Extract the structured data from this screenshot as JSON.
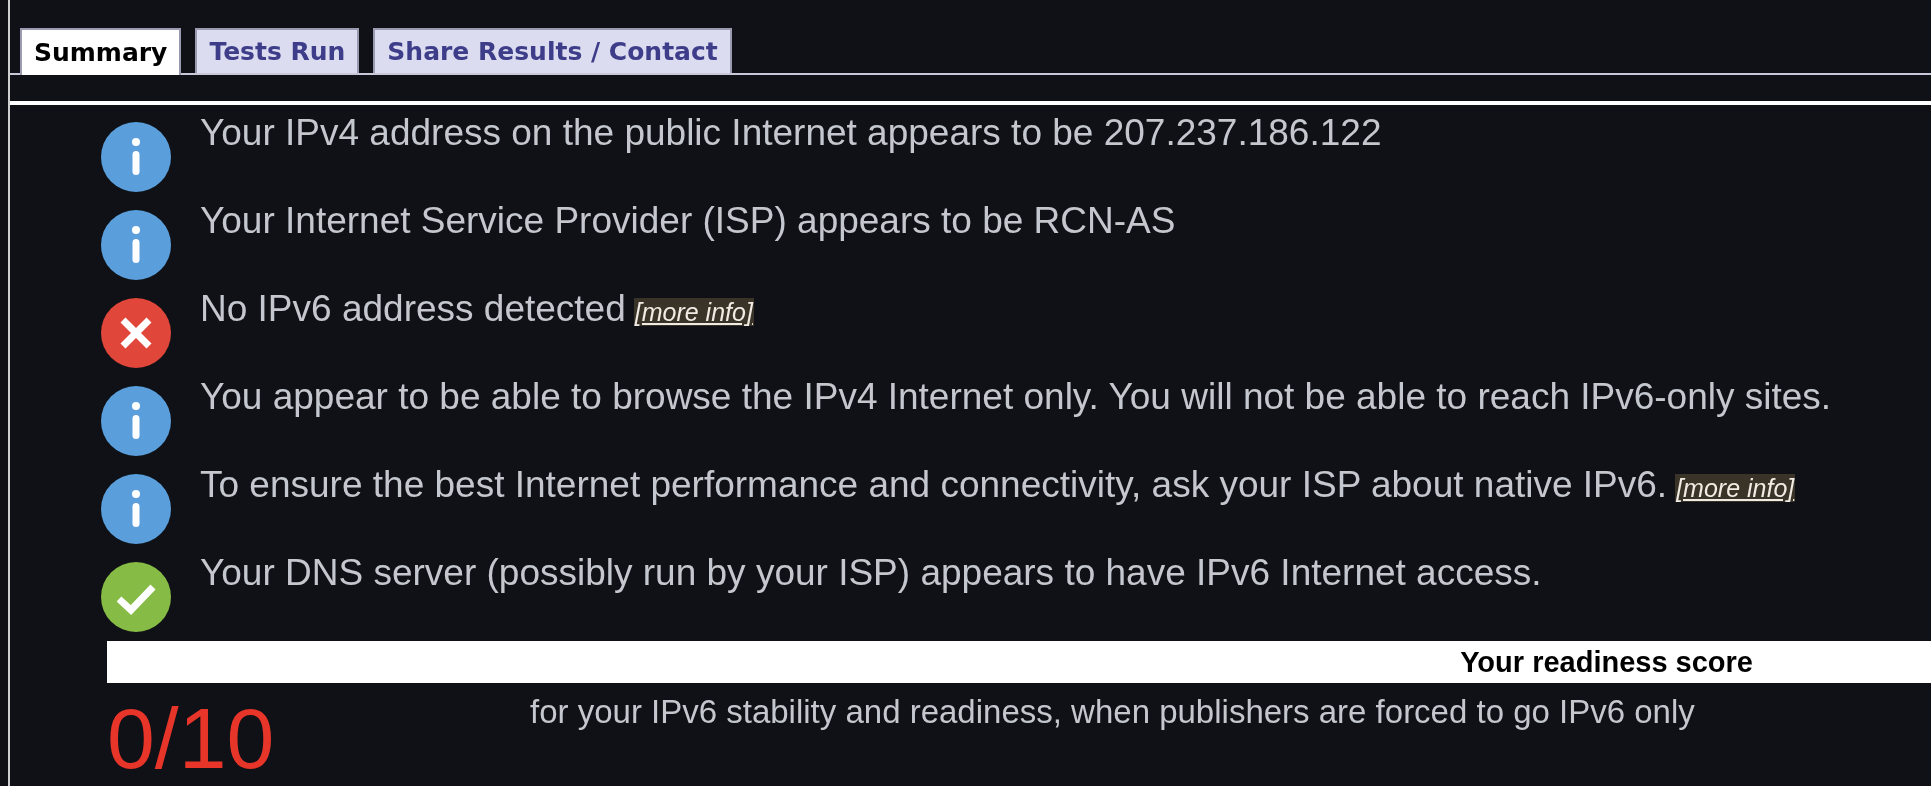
{
  "tabs": [
    {
      "label": "Summary",
      "selected": true
    },
    {
      "label": "Tests Run",
      "selected": false
    },
    {
      "label": "Share Results / Contact",
      "selected": false
    }
  ],
  "results": [
    {
      "kind": "info",
      "text": "Your IPv4 address on the public Internet appears to be 207.237.186.122"
    },
    {
      "kind": "info",
      "text": "Your Internet Service Provider (ISP) appears to be RCN-AS"
    },
    {
      "kind": "error",
      "text": "No IPv6 address detected",
      "link": "[more info]"
    },
    {
      "kind": "info",
      "text": "You appear to be able to browse the IPv4 Internet only. You will not be able to reach IPv6-only sites."
    },
    {
      "kind": "info",
      "text": "To ensure the best Internet performance and connectivity, ask your ISP about native IPv6.",
      "link": "[more info]"
    },
    {
      "kind": "ok",
      "text": "Your DNS server (possibly run by your ISP) appears to have IPv6 Internet access."
    }
  ],
  "score": {
    "heading": "Your readiness score",
    "value": "0/10",
    "description": "for your IPv6 stability and readiness, when publishers are forced to go IPv6 only"
  }
}
